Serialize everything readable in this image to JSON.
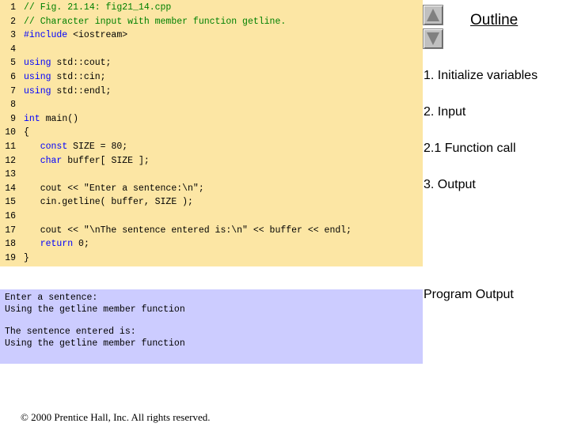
{
  "code": {
    "lines": [
      {
        "num": "1",
        "segments": [
          {
            "kind": "cm",
            "text": "// Fig. 21.14: fig21_14.cpp"
          }
        ]
      },
      {
        "num": "2",
        "segments": [
          {
            "kind": "cm",
            "text": "// Character input with member function getline."
          }
        ]
      },
      {
        "num": "3",
        "segments": [
          {
            "kind": "kw",
            "text": "#include"
          },
          {
            "kind": "tx",
            "text": " <iostream>"
          }
        ]
      },
      {
        "num": "4",
        "segments": []
      },
      {
        "num": "5",
        "segments": [
          {
            "kind": "kw",
            "text": "using"
          },
          {
            "kind": "tx",
            "text": " std::cout;"
          }
        ]
      },
      {
        "num": "6",
        "segments": [
          {
            "kind": "kw",
            "text": "using"
          },
          {
            "kind": "tx",
            "text": " std::cin;"
          }
        ]
      },
      {
        "num": "7",
        "segments": [
          {
            "kind": "kw",
            "text": "using"
          },
          {
            "kind": "tx",
            "text": " std::endl;"
          }
        ]
      },
      {
        "num": "8",
        "segments": []
      },
      {
        "num": "9",
        "segments": [
          {
            "kind": "kw",
            "text": "int"
          },
          {
            "kind": "tx",
            "text": " main()"
          }
        ]
      },
      {
        "num": "10",
        "segments": [
          {
            "kind": "tx",
            "text": "{"
          }
        ]
      },
      {
        "num": "11",
        "segments": [
          {
            "kind": "tx",
            "text": "   "
          },
          {
            "kind": "kw",
            "text": "const"
          },
          {
            "kind": "tx",
            "text": " SIZE = 80;"
          }
        ]
      },
      {
        "num": "12",
        "segments": [
          {
            "kind": "tx",
            "text": "   "
          },
          {
            "kind": "kw",
            "text": "char"
          },
          {
            "kind": "tx",
            "text": " buffer[ SIZE ];"
          }
        ]
      },
      {
        "num": "13",
        "segments": []
      },
      {
        "num": "14",
        "segments": [
          {
            "kind": "tx",
            "text": "   cout << \"Enter a sentence:\\n\";"
          }
        ]
      },
      {
        "num": "15",
        "segments": [
          {
            "kind": "tx",
            "text": "   cin.getline( buffer, SIZE );"
          }
        ]
      },
      {
        "num": "16",
        "segments": []
      },
      {
        "num": "17",
        "segments": [
          {
            "kind": "tx",
            "text": "   cout << \"\\nThe sentence entered is:\\n\" << buffer << endl;"
          }
        ]
      },
      {
        "num": "18",
        "segments": [
          {
            "kind": "tx",
            "text": "   "
          },
          {
            "kind": "kw",
            "text": "return"
          },
          {
            "kind": "tx",
            "text": " 0;"
          }
        ]
      },
      {
        "num": "19",
        "segments": [
          {
            "kind": "tx",
            "text": "}"
          }
        ]
      }
    ]
  },
  "outline": {
    "title": "Outline",
    "items": [
      "1. Initialize variables",
      "2. Input",
      "2.1 Function call",
      "3. Output"
    ],
    "program_output_label": "Program Output"
  },
  "nav": {
    "up_icon": "triangle-up-icon",
    "down_icon": "triangle-down-icon"
  },
  "output": {
    "lines": [
      "Enter a sentence:",
      "Using the getline member function",
      "",
      "The sentence entered is:",
      "Using the getline member function"
    ]
  },
  "footer": {
    "copyright": "© 2000 Prentice Hall, Inc.  All rights reserved."
  },
  "colors": {
    "code_bg": "#fce6a4",
    "output_bg": "#ccccff",
    "comment": "#008000",
    "keyword": "#0000ff"
  }
}
